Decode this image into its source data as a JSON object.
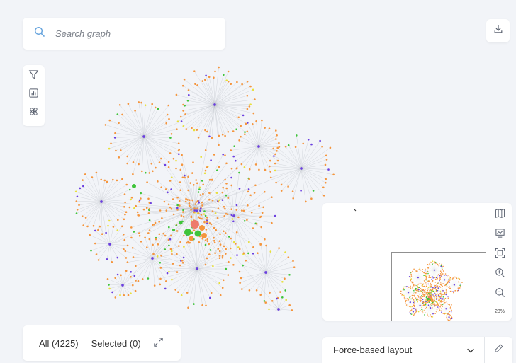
{
  "search": {
    "placeholder": "Search graph"
  },
  "toolbar": {
    "tools": [
      "filter-icon",
      "stats-icon",
      "molecule-icon"
    ]
  },
  "download": {
    "icon": "download-icon"
  },
  "counts": {
    "all_label": "All (4225)",
    "selected_label": "Selected (0)"
  },
  "layout": {
    "selected": "Force-based layout"
  },
  "minimap": {
    "tools": [
      "map-icon",
      "chart-icon",
      "fit-screen-icon",
      "zoom-in-icon",
      "zoom-out-icon"
    ],
    "zoom_label": "28%"
  },
  "colors": {
    "background": "#f2f4f8",
    "node_orange": "#f5953d",
    "node_green": "#3fc43a",
    "node_purple": "#6b3fe0",
    "node_yellow": "#e8e03a",
    "node_salmon": "#ee7b6b",
    "edge": "#9aa0a8",
    "icon": "#5b6270",
    "search_icon": "#6aa6de"
  }
}
